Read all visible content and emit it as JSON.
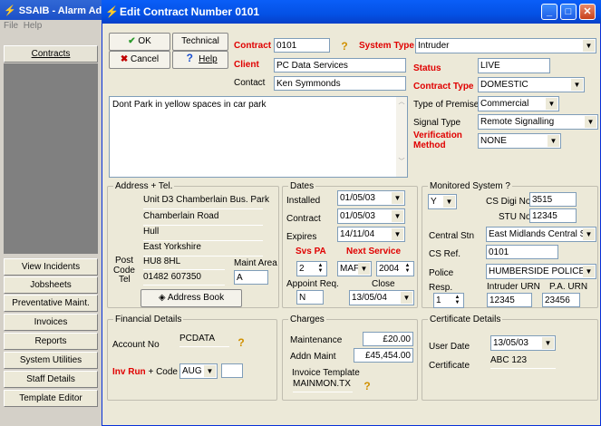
{
  "back": {
    "title": "SSAIB - Alarm Ad",
    "menu_file": "File",
    "menu_help": "Help",
    "nav": [
      "Contracts",
      "View Incidents",
      "Jobsheets",
      "Preventative Maint.",
      "Invoices",
      "Reports",
      "System Utilities",
      "Staff Details",
      "Template Editor"
    ]
  },
  "dialog": {
    "title": "Edit Contract Number 0101",
    "ok": "OK",
    "cancel": "Cancel",
    "technical": "Technical",
    "help": "Help",
    "contract_label": "Contract",
    "contract": "0101",
    "system_type_label": "System Type",
    "system_type": "Intruder",
    "client_label": "Client",
    "client": "PC Data Services",
    "contact_label": "Contact",
    "contact": "Ken Symmonds",
    "status_label": "Status",
    "status": "LIVE",
    "contract_type_label": "Contract Type",
    "contract_type": "DOMESTIC",
    "premises_label": "Type of Premises",
    "premises": "Commercial",
    "signal_label": "Signal Type",
    "signal": "Remote Signalling",
    "verif_label": "Verification Method",
    "verif": "NONE",
    "notes": "Dont Park in yellow spaces in car park",
    "address_group": "Address + Tel.",
    "addr": [
      "Unit D3 Chamberlain Bus. Park",
      "Chamberlain Road",
      "Hull",
      "East Yorkshire"
    ],
    "postcode_label": "Post Code",
    "postcode": "HU8 8HL",
    "tel_label": "Tel",
    "tel": "01482 607350",
    "maint_area_label": "Maint Area",
    "maint_area": "A",
    "address_book": "Address Book",
    "dates_group": "Dates",
    "installed_label": "Installed",
    "installed": "01/05/03",
    "contract_date_label": "Contract",
    "contract_date": "01/05/03",
    "expires_label": "Expires",
    "expires": "14/11/04",
    "svspa_label": "Svs PA",
    "svspa": "2",
    "next_service_label": "Next Service",
    "next_month": "MAF",
    "next_year": "2004",
    "appoint_label": "Appoint Req.",
    "appoint": "N",
    "close_label": "Close",
    "close": "13/05/04",
    "monitored_group": "Monitored System ?",
    "monitored": "Y",
    "digi_label": "CS Digi No.",
    "digi": "3515",
    "stu_label": "STU No",
    "stu": "12345",
    "central_label": "Central Stn",
    "central": "East Midlands Central Stn",
    "csref_label": "CS Ref.",
    "csref": "0101",
    "police_label": "Police",
    "police": "HUMBERSIDE POLICE",
    "resp_label": "Resp.",
    "resp": "1",
    "intruder_urn_label": "Intruder URN",
    "intruder_urn": "12345",
    "pa_urn_label": "P.A. URN",
    "pa_urn": "23456",
    "financial_group": "Financial Details",
    "account_label": "Account No",
    "account": "PCDATA",
    "invrun_label": "Inv Run",
    "code_label": "+ Code",
    "invrun": "AUG",
    "code": "",
    "charges_group": "Charges",
    "maintenance_label": "Maintenance",
    "maintenance": "£20.00",
    "addn_label": "Addn Maint",
    "addn": "£45,454.00",
    "template_label": "Invoice Template",
    "template": "MAINMON.TX",
    "cert_group": "Certificate Details",
    "user_date_label": "User Date",
    "user_date": "13/05/03",
    "certificate_label": "Certificate",
    "certificate": "ABC 123"
  }
}
